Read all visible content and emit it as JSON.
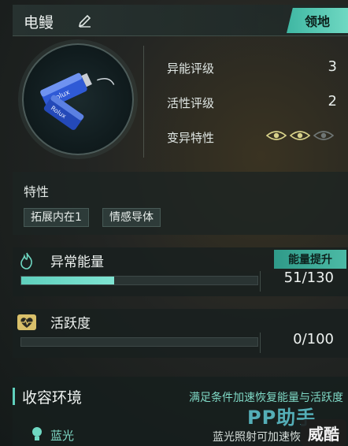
{
  "header": {
    "name": "电鳗",
    "territory_label": "领地"
  },
  "stats": [
    {
      "label": "异能评级",
      "value": "3"
    },
    {
      "label": "活性评级",
      "value": "2"
    },
    {
      "label": "变异特性",
      "value": ""
    }
  ],
  "mutation_eyes": {
    "active": 2,
    "total": 3
  },
  "traits": {
    "title": "特性",
    "tags": [
      "拓展内在1",
      "情感导体"
    ]
  },
  "anomaly_energy": {
    "title": "异常能量",
    "boost_label": "能量提升",
    "current": 51,
    "max": 130,
    "value_text": "51/130"
  },
  "activity": {
    "title": "活跃度",
    "current": 0,
    "max": 100,
    "value_text": "0/100"
  },
  "environment": {
    "title": "收容环境",
    "hint": "满足条件加速恢复能量与活跃度",
    "light_label": "蓝光",
    "light_desc": "蓝光照射可加速恢"
  },
  "watermark": {
    "text": "PP助手",
    "badge": "威酷"
  },
  "colors": {
    "accent": "#5fd0bd",
    "header_tab": "#4cbaa5",
    "eye_active": "#d8d28a"
  }
}
